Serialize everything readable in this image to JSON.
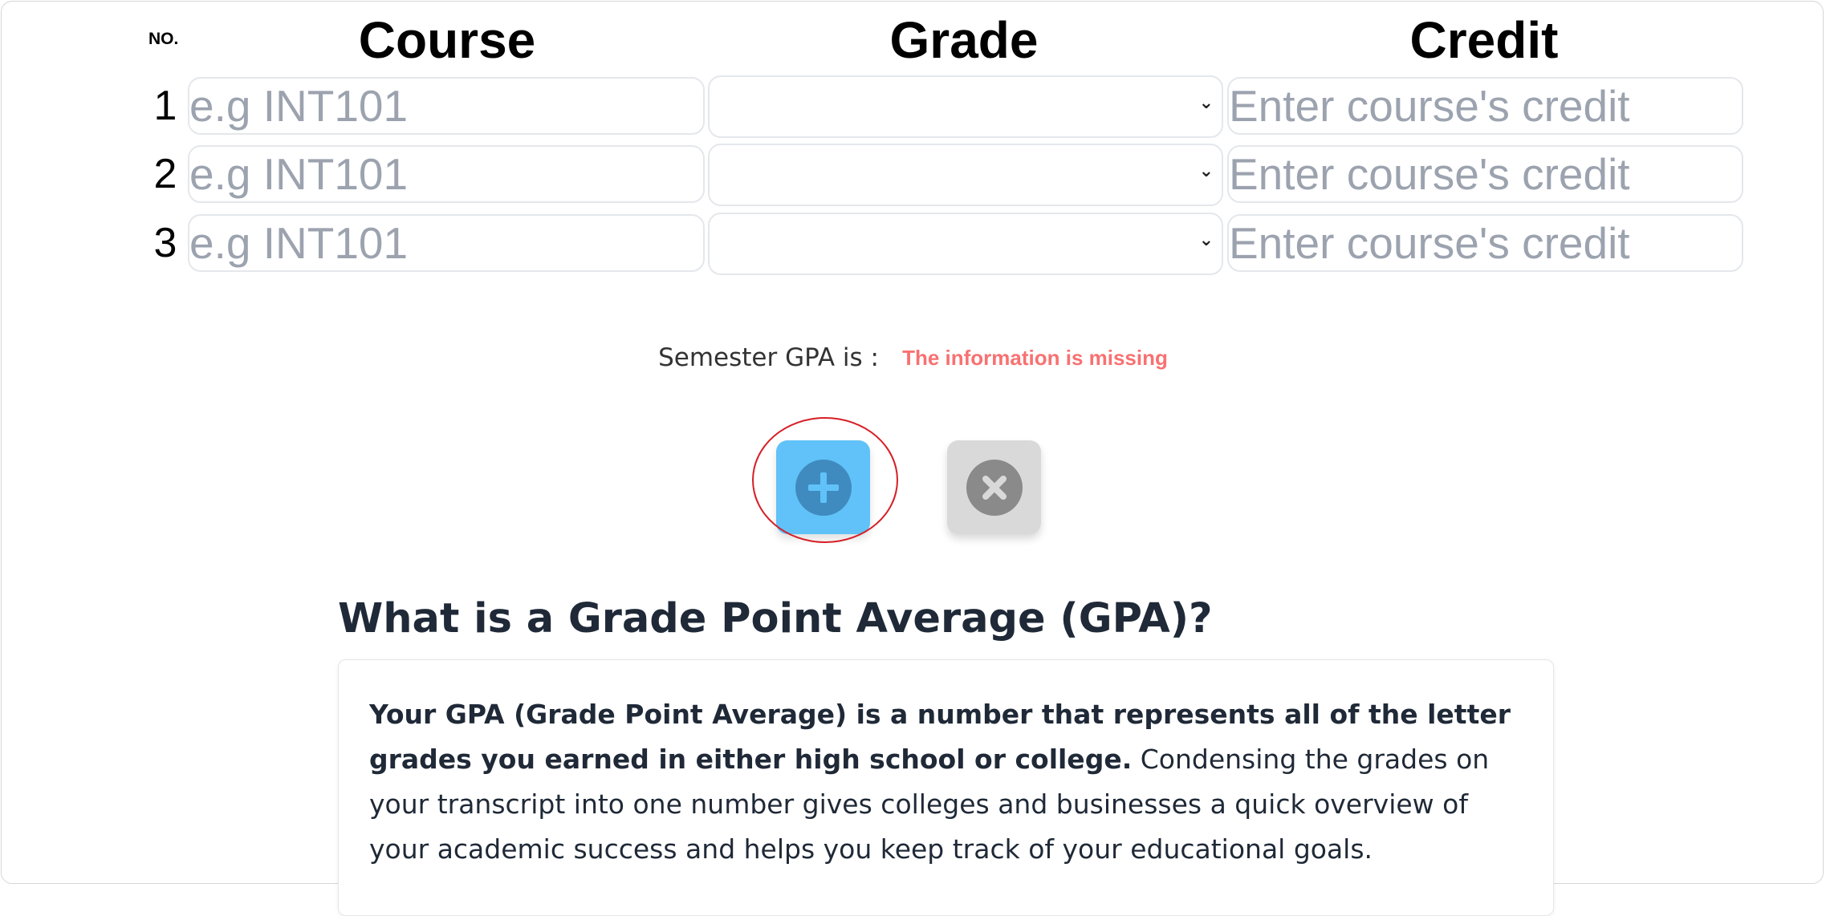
{
  "table": {
    "no_header": "NO.",
    "course_header": "Course",
    "grade_header": "Grade",
    "credit_header": "Credit",
    "rows": [
      {
        "number": "1",
        "course_placeholder": "e.g INT101",
        "credit_placeholder": "Enter course's credit",
        "grade_value": ""
      },
      {
        "number": "2",
        "course_placeholder": "e.g INT101",
        "credit_placeholder": "Enter course's credit",
        "grade_value": ""
      },
      {
        "number": "3",
        "course_placeholder": "e.g INT101",
        "credit_placeholder": "Enter course's credit",
        "grade_value": ""
      }
    ]
  },
  "gpa": {
    "label": "Semester GPA is :",
    "status": "The information is missing",
    "status_color": "#f87171"
  },
  "actions": {
    "add_icon": "plus-circle-icon",
    "add_color": "#60c2f8",
    "clear_icon": "x-circle-icon",
    "clear_color": "#d9d9d9"
  },
  "article": {
    "title": "What is a Grade Point Average (GPA)?",
    "bold_text": "Your GPA (Grade Point Average) is a number that represents all of the letter grades you earned in either high school or college.",
    "body_text": " Condensing the grades on your transcript into one number gives colleges and businesses a quick overview of your academic success and helps you keep track of your educational goals."
  }
}
